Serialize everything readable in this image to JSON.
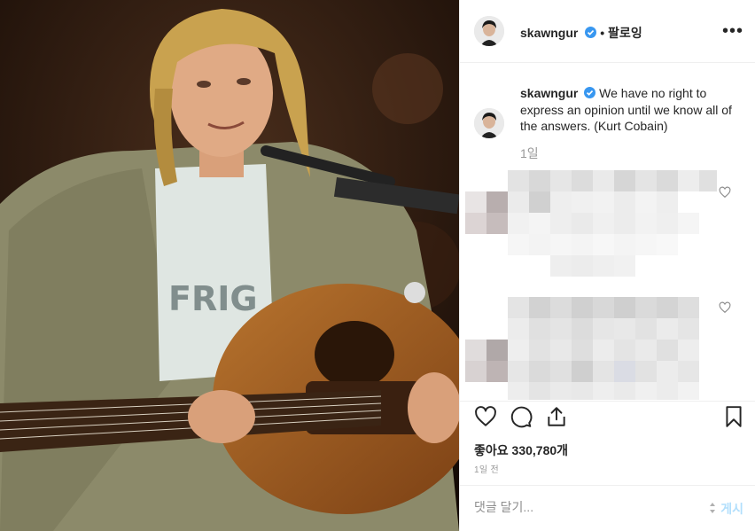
{
  "post": {
    "username": "skawngur",
    "follow_label": "• 팔로잉",
    "more_label": "•••",
    "caption_username": "skawngur",
    "caption_text": "We have no right to express an opinion until we know all of the answers. (Kurt Cobain)",
    "caption_age": "1일",
    "likes_text": "좋아요 330,780개",
    "posted_ago": "1일 전"
  },
  "comment_box": {
    "placeholder": "댓글 달기...",
    "post_label": "게시"
  },
  "colors": {
    "verified": "#3897f0",
    "post_button": "#b2dffc",
    "muted": "#999999",
    "border": "#efefef"
  },
  "icons": {
    "like": "heart-icon",
    "comment": "comment-icon",
    "share": "share-icon",
    "save": "bookmark-icon",
    "more": "more-icon",
    "verified": "verified-badge-icon"
  }
}
